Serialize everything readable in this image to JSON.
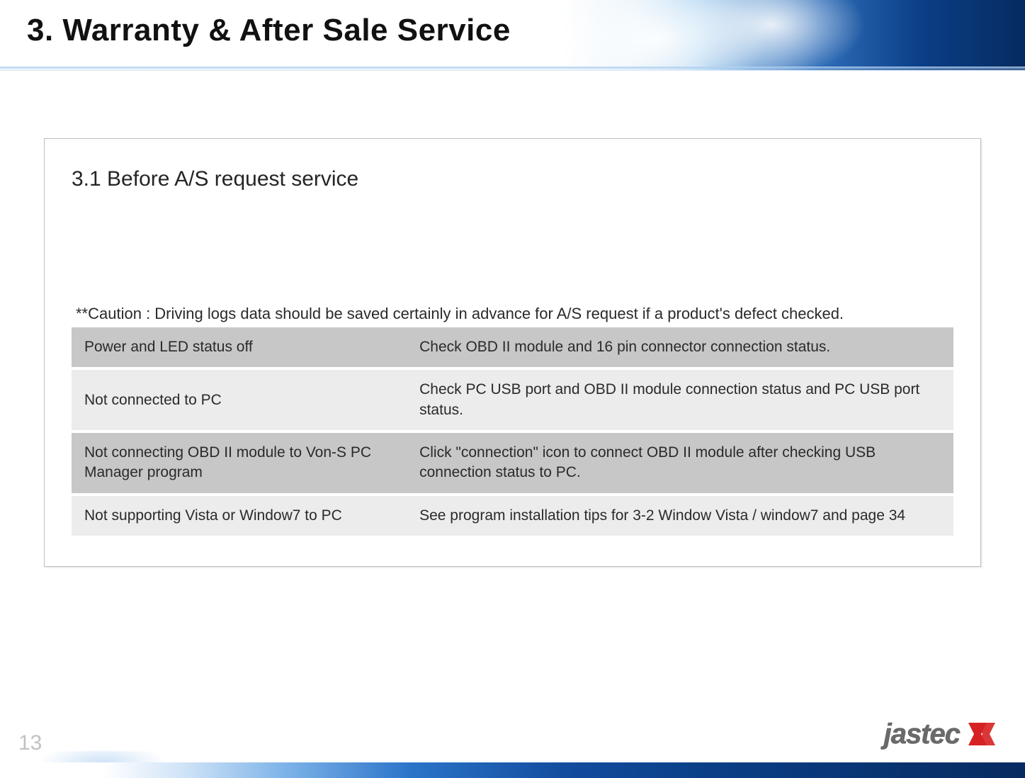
{
  "header": {
    "title": "3.  Warranty & After Sale Service"
  },
  "section": {
    "heading": "3.1 Before A/S request service",
    "caution": "**Caution : Driving logs data should be  saved certainly in advance for A/S request if a product's defect checked."
  },
  "table": {
    "rows": [
      {
        "issue": "Power and LED status off",
        "action": "Check OBD II module and 16 pin connector connection status.",
        "tone": "dark"
      },
      {
        "issue": "Not connected to PC",
        "action": "Check PC USB port and OBD II module connection status and PC USB port status.",
        "tone": "light"
      },
      {
        "issue": "Not connecting OBD II module to Von-S PC Manager program",
        "action": "Click \"connection\" icon to connect OBD II module after checking USB connection status to PC.",
        "tone": "dark"
      },
      {
        "issue": "Not supporting Vista or Window7 to PC",
        "action": "See program installation tips for 3-2 Window Vista / window7 and page 34",
        "tone": "light"
      }
    ]
  },
  "footer": {
    "page_number": "13",
    "logo_text": "jastec"
  }
}
